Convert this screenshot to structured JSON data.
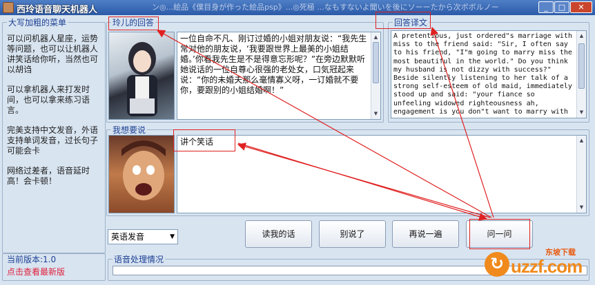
{
  "window": {
    "title": "西玲语音聊天机器人",
    "background_title_text": "ン◎...絵品《僕目身が作った絵品psp》...◎死極 ...なもすないよ聞いを後にソーーたから次ボボルノー",
    "controls": {
      "minimize": "_",
      "maximize": "□",
      "close": "✕"
    }
  },
  "menu_group": {
    "legend": "大写加粗的菜单",
    "paragraphs": [
      "可以问机器人星座，运势等问题，也可以让机器人讲笑话给你听，当然也可以胡诌",
      "可以拿机器人来打发时间，也可以拿来练习语言。",
      "完美支持中文发音，外语支持单词发音，过长句子可能会卡",
      "网络过差者，语音延时高！会卡顿！"
    ]
  },
  "reply_group": {
    "legend": "玲儿的回答",
    "text": "一位自命不凡、刚订过婚的小姐对朋友说：“我先生常对他的朋友说，‘我要跟世界上最美的小姐结婚。’你看我先生是不是得意忘形呢？”在旁边默默听她说话的一位自尊心很强的老处女，口気冠起来说：“你的未婚夫那么毫情寡义呀，一订婚就不要你，要跟别的小姐结婚啊！”"
  },
  "translation_group": {
    "legend": "回答译文",
    "lines": [
      "A pretentious, just ordered\"s marriage with",
      "miss to the friend said: \"Sir, I often say",
      "to his friend, \"I\"m going to marry miss the",
      "most beautiful in the world.\" Do you think",
      "my husband is not dizzy with success?\"",
      "Beside silently listening to her talk of a",
      "strong self-esteem of old maid, immediately",
      "stood up and said: \"your fiance so",
      "unfeeling widowed righteousness ah,",
      "engagement is you don\"t want to marry with"
    ]
  },
  "input_group": {
    "legend": "我想要说",
    "value": "讲个笑话"
  },
  "controls": {
    "voice_select": {
      "selected": "英语发音"
    },
    "buttons": {
      "read": "读我的话",
      "stop": "别说了",
      "repeat": "再说一遍",
      "ask": "问一问"
    }
  },
  "footer": {
    "version_label": "当前版本:1.0",
    "check_latest": "点击查看最新版",
    "status_legend": "语音处理情况",
    "progress": 0
  },
  "watermark": {
    "line1": "东坡下载",
    "line2": "uzzf.com"
  },
  "colors": {
    "accent_blue": "#1c3f94",
    "annotation_red": "#e02020",
    "link_red": "#e0203c"
  }
}
